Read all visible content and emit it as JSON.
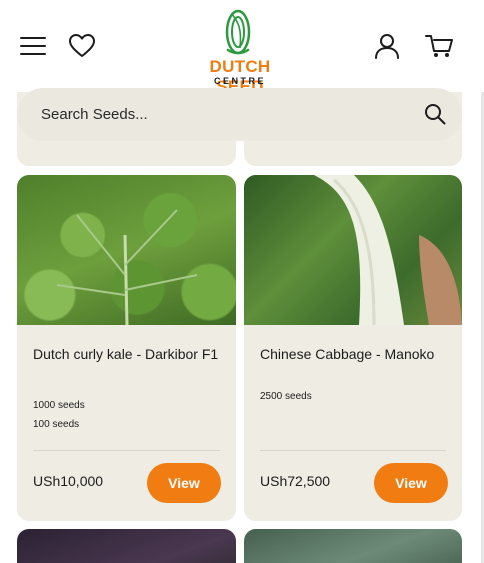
{
  "header": {
    "logo_main": "DUTCH SEED",
    "logo_sub": "CENTRE"
  },
  "search": {
    "placeholder": "Search Seeds..."
  },
  "products": [
    {
      "title": "Dutch curly kale - Darkibor F1",
      "variants": [
        "1000 seeds",
        "100 seeds"
      ],
      "price": "USh10,000",
      "button": "View"
    },
    {
      "title": "Chinese Cabbage - Manoko",
      "variants": [
        "2500 seeds"
      ],
      "price": "USh72,500",
      "button": "View"
    }
  ],
  "colors": {
    "accent": "#f07c12",
    "card_bg": "#efece4",
    "search_bg": "#ebe8e0"
  }
}
